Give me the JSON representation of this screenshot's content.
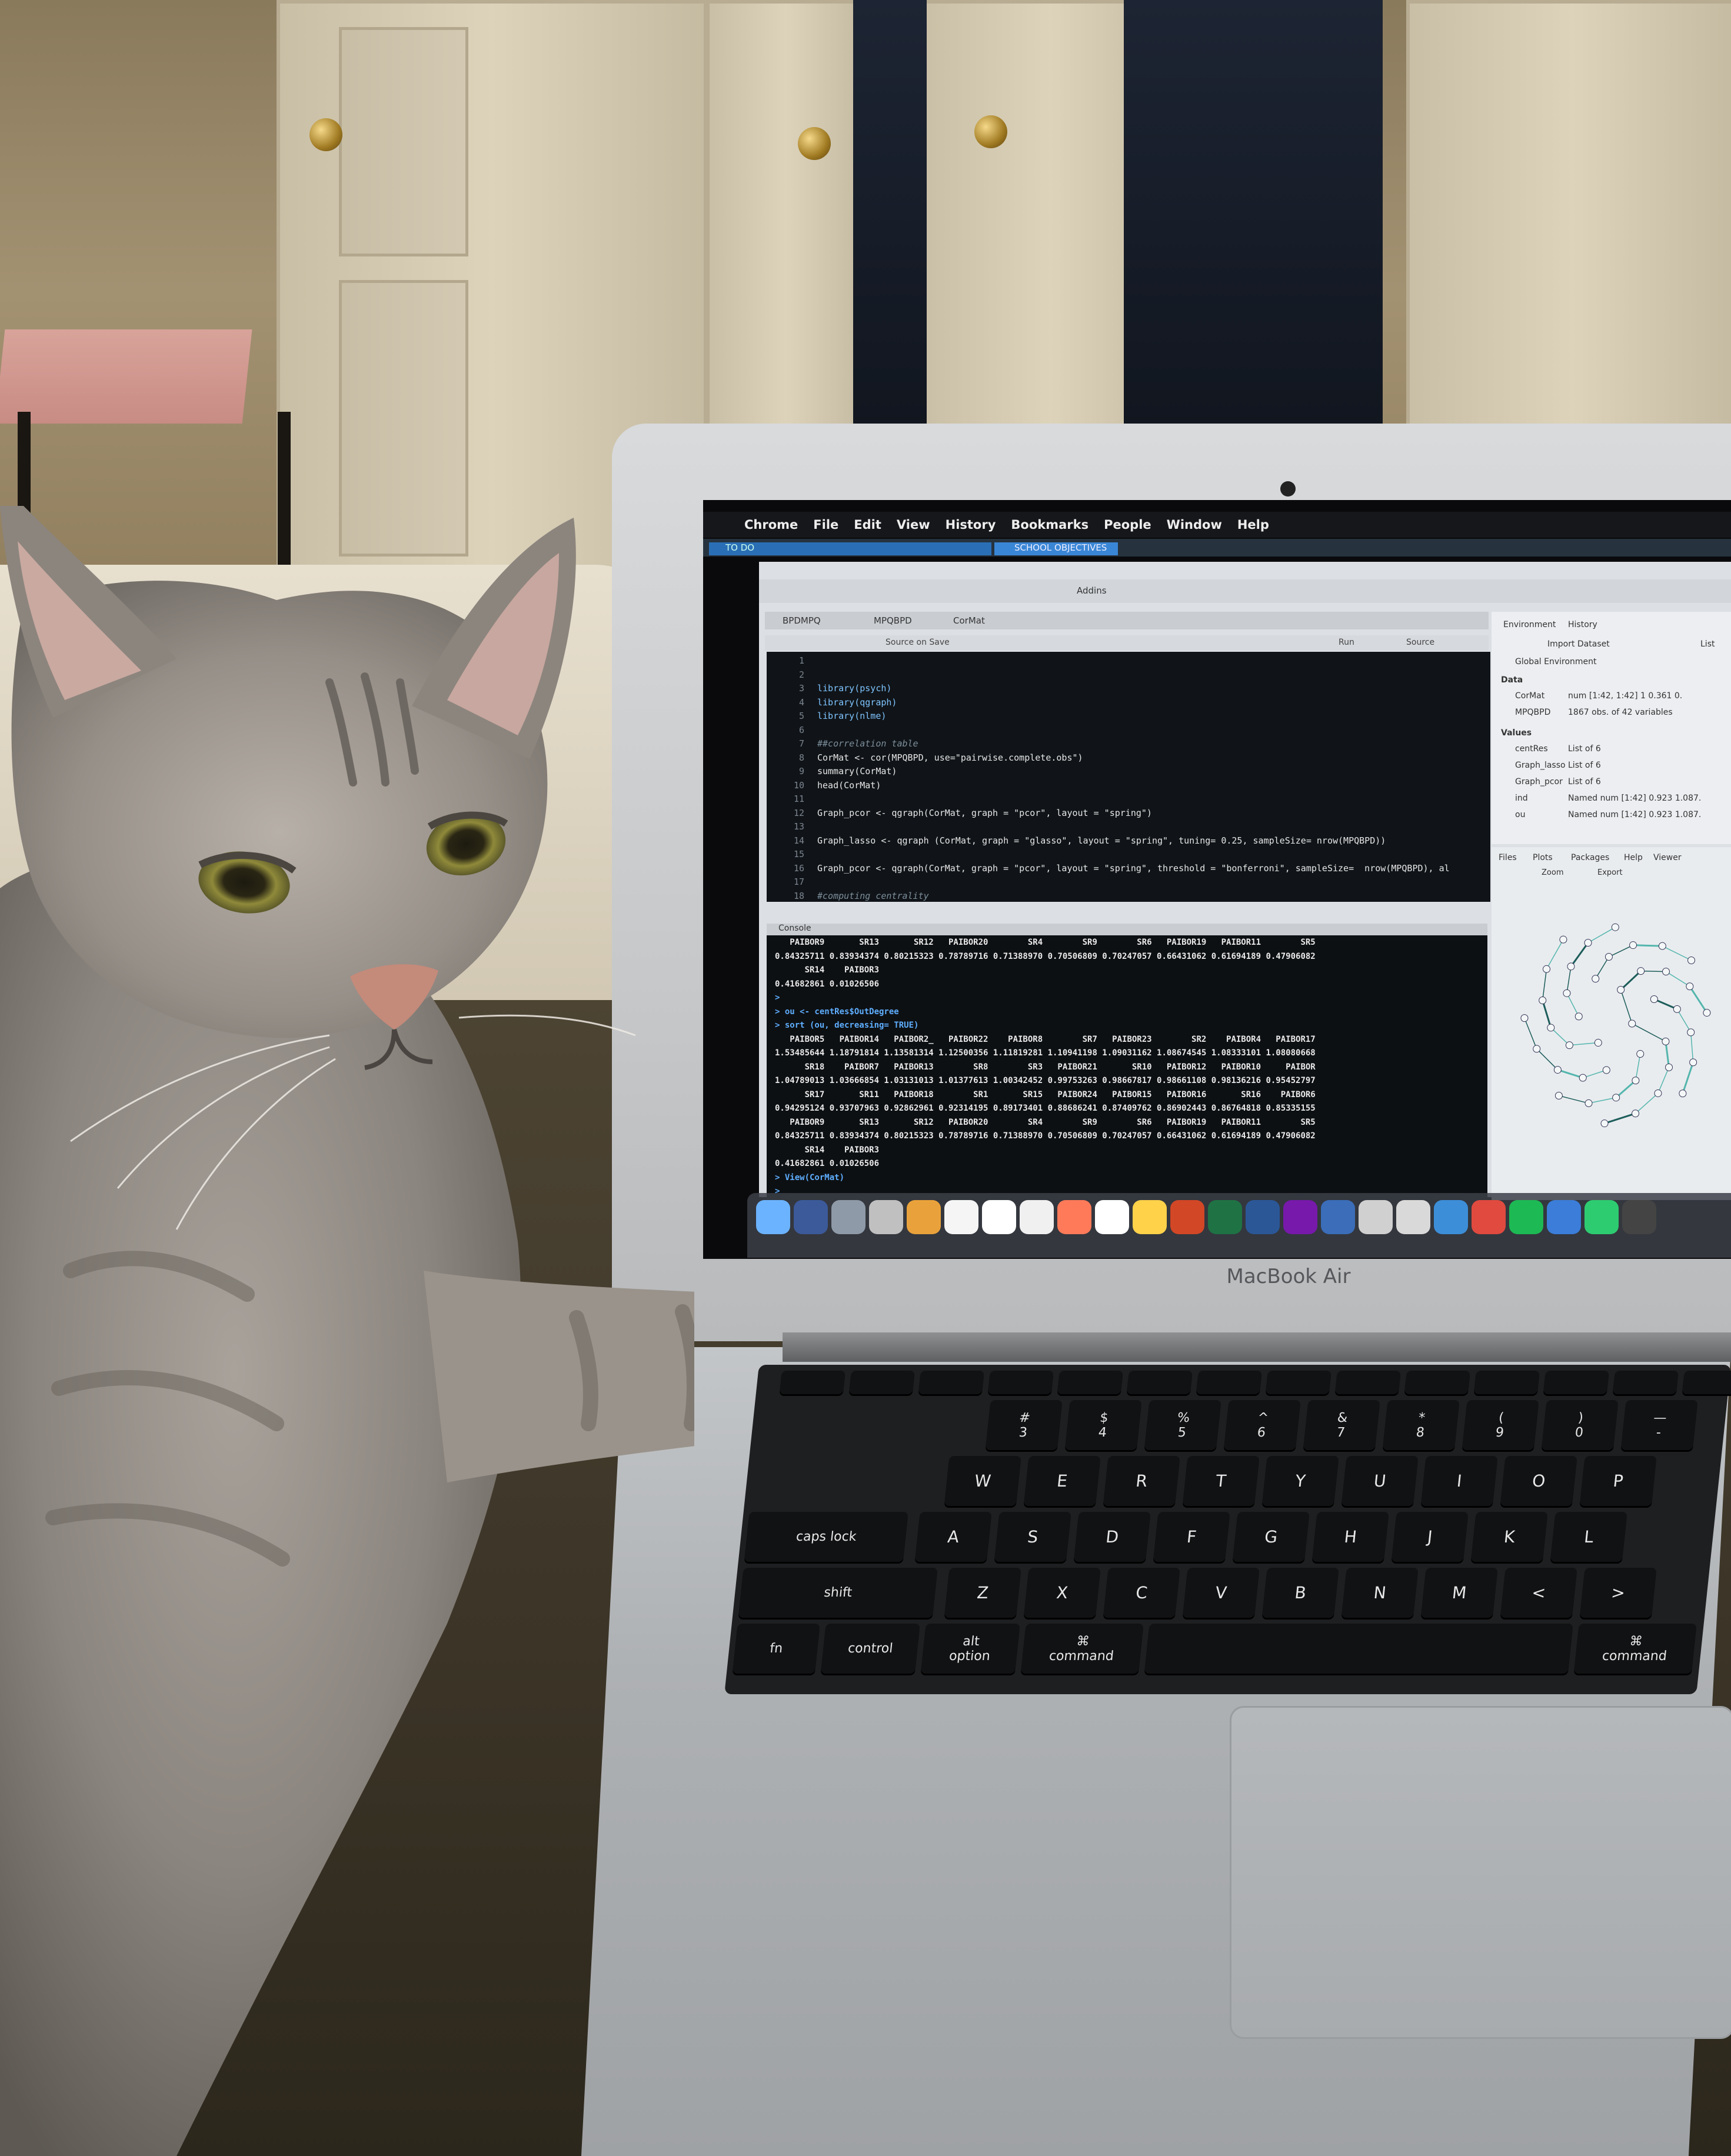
{
  "scene": {
    "device_label": "MacBook Air"
  },
  "menubar": {
    "items": [
      "Chrome",
      "File",
      "Edit",
      "View",
      "History",
      "Bookmarks",
      "People",
      "Window",
      "Help"
    ]
  },
  "browser_tabs": [
    "TO DO",
    "SCHOOL OBJECTIVES"
  ],
  "rstudio": {
    "toolbar": {
      "addins": "Addins"
    },
    "editor_tabs": [
      "BPDMPQ",
      "MPQBPD",
      "CorMat"
    ],
    "editor_toolbar": {
      "source_on_save": "Source on Save",
      "run": "Run",
      "source": "Source"
    },
    "code": [
      {
        "n": "1",
        "t": ""
      },
      {
        "n": "2",
        "t": ""
      },
      {
        "n": "3",
        "t": "library(psych)"
      },
      {
        "n": "4",
        "t": "library(qgraph)"
      },
      {
        "n": "5",
        "t": "library(nlme)"
      },
      {
        "n": "6",
        "t": ""
      },
      {
        "n": "7",
        "t": "##correlation table"
      },
      {
        "n": "8",
        "t": "CorMat <- cor(MPQBPD, use=\"pairwise.complete.obs\")"
      },
      {
        "n": "9",
        "t": "summary(CorMat)"
      },
      {
        "n": "10",
        "t": "head(CorMat)"
      },
      {
        "n": "11",
        "t": ""
      },
      {
        "n": "12",
        "t": "Graph_pcor <- qgraph(CorMat, graph = \"pcor\", layout = \"spring\")"
      },
      {
        "n": "13",
        "t": ""
      },
      {
        "n": "14",
        "t": "Graph_lasso <- qgraph (CorMat, graph = \"glasso\", layout = \"spring\", tuning= 0.25, sampleSize= nrow(MPQBPD))"
      },
      {
        "n": "15",
        "t": ""
      },
      {
        "n": "16",
        "t": "Graph_pcor <- qgraph(CorMat, graph = \"pcor\", layout = \"spring\", threshold = \"bonferroni\", sampleSize=  nrow(MPQBPD), al"
      },
      {
        "n": "17",
        "t": ""
      },
      {
        "n": "18",
        "t": "#computing centrality"
      }
    ],
    "console_header": "Console",
    "console": [
      "   PAIBOR9       SR13       SR12   PAIBOR20        SR4        SR9        SR6   PAIBOR19   PAIBOR11        SR5",
      "0.84325711 0.83934374 0.80215323 0.78789716 0.71388970 0.70506809 0.70247057 0.66431062 0.61694189 0.47906082",
      "      SR14    PAIBOR3",
      "0.41682861 0.01026506",
      ">",
      "> ou <- centRes$OutDegree",
      "> sort (ou, decreasing= TRUE)",
      "   PAIBOR5   PAIBOR14   PAIBOR2_   PAIBOR22    PAIBOR8        SR7   PAIBOR23        SR2    PAIBOR4   PAIBOR17",
      "1.53485644 1.18791814 1.13581314 1.12500356 1.11819281 1.10941198 1.09031162 1.08674545 1.08333101 1.08080668",
      "      SR18    PAIBOR7   PAIBOR13        SR8        SR3   PAIBOR21       SR10   PAIBOR12   PAIBOR10     PAIBOR",
      "1.04789013 1.03666854 1.03131013 1.01377613 1.00342452 0.99753263 0.98667817 0.98661108 0.98136216 0.95452797",
      "      SR17       SR11   PAIBOR18        SR1       SR15   PAIBOR24   PAIBOR15   PAIBOR16       SR16    PAIBOR6",
      "0.94295124 0.93707963 0.92862961 0.92314195 0.89173401 0.88686241 0.87409762 0.86902443 0.86764818 0.85335155",
      "   PAIBOR9       SR13       SR12   PAIBOR20        SR4        SR9        SR6   PAIBOR19   PAIBOR11        SR5",
      "0.84325711 0.83934374 0.80215323 0.78789716 0.71388970 0.70506809 0.70247057 0.66431062 0.61694189 0.47906082",
      "      SR14    PAIBOR3",
      "0.41682861 0.01026506",
      "> View(CorMat)",
      ">"
    ],
    "environment": {
      "tabs": [
        "Environment",
        "History"
      ],
      "import": "Import Dataset",
      "scope": "Global Environment",
      "list_label": "List",
      "data_header": "Data",
      "values_header": "Values",
      "data_rows": [
        {
          "name": "CorMat",
          "value": "num [1:42, 1:42] 1 0.361 0."
        },
        {
          "name": "MPQBPD",
          "value": "1867 obs. of 42 variables"
        }
      ],
      "value_rows": [
        {
          "name": "centRes",
          "value": "List of 6"
        },
        {
          "name": "Graph_lasso",
          "value": "List of 6"
        },
        {
          "name": "Graph_pcor",
          "value": "List of 6"
        },
        {
          "name": "ind",
          "value": "Named num [1:42] 0.923 1.087."
        },
        {
          "name": "ou",
          "value": "Named num [1:42] 0.923 1.087."
        }
      ]
    },
    "files_pane": {
      "tabs": [
        "Files",
        "Plots",
        "Packages",
        "Help",
        "Viewer"
      ],
      "zoom": "Zoom",
      "export": "Export"
    }
  },
  "keyboard": {
    "row1": [
      "#\n3",
      "$\n4",
      "%\n5",
      "^\n6",
      "&\n7",
      "*\n8",
      "(\n9",
      ")\n0",
      "—\n-"
    ],
    "row2": [
      "W",
      "E",
      "R",
      "T",
      "Y",
      "U",
      "I",
      "O",
      "P"
    ],
    "row3": [
      "A",
      "S",
      "D",
      "F",
      "G",
      "H",
      "J",
      "K",
      "L"
    ],
    "row4": [
      "Z",
      "X",
      "C",
      "V",
      "B",
      "N",
      "M",
      "<",
      ">"
    ],
    "caps": "caps lock",
    "shift": "shift",
    "fn": "fn",
    "control": "control",
    "option": "option",
    "alt": "alt",
    "command": "command"
  },
  "colors": {
    "cat_fur": "#8f8a86",
    "screen_bg": "#0a0a0c",
    "tab_blue": "#2a6fb5"
  }
}
